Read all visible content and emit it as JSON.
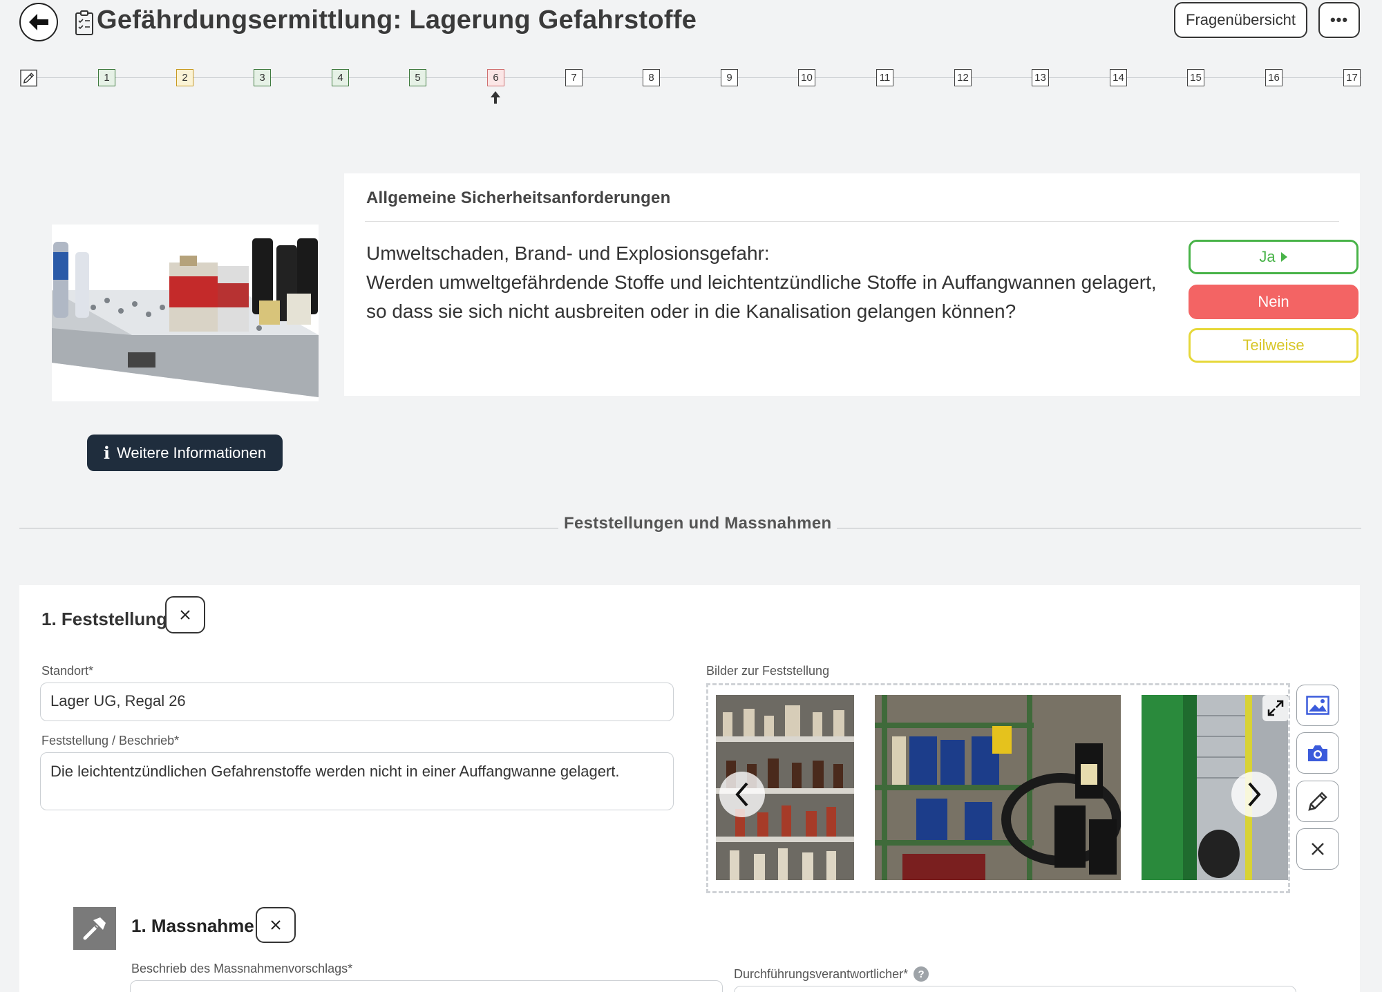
{
  "header": {
    "title": "Gefährdungsermittlung: Lagerung Gefahrstoffe",
    "overview_label": "Fragenübersicht",
    "more_label": "•••"
  },
  "stepper": {
    "current": 6,
    "steps": [
      {
        "label": "1",
        "status": "green"
      },
      {
        "label": "2",
        "status": "yellow"
      },
      {
        "label": "3",
        "status": "green"
      },
      {
        "label": "4",
        "status": "green"
      },
      {
        "label": "5",
        "status": "green"
      },
      {
        "label": "6",
        "status": "red"
      },
      {
        "label": "7",
        "status": "open"
      },
      {
        "label": "8",
        "status": "open"
      },
      {
        "label": "9",
        "status": "open"
      },
      {
        "label": "10",
        "status": "open"
      },
      {
        "label": "11",
        "status": "open"
      },
      {
        "label": "12",
        "status": "open"
      },
      {
        "label": "13",
        "status": "open"
      },
      {
        "label": "14",
        "status": "open"
      },
      {
        "label": "15",
        "status": "open"
      },
      {
        "label": "16",
        "status": "open"
      },
      {
        "label": "17",
        "status": "open"
      }
    ]
  },
  "question": {
    "section": "Allgemeine Sicherheitsanforderungen",
    "line1": "Umweltschaden, Brand- und Explosionsgefahr:",
    "line2": "Werden umweltgefährdende Stoffe und leichtentzündliche Stoffe in Auffangwannen gelagert,",
    "line3": "so dass sie sich nicht ausbreiten oder in die Kanalisation gelangen können?",
    "answers": {
      "yes": "Ja",
      "no": "Nein",
      "partial": "Teilweise"
    },
    "selected": "Nein",
    "info_button": "Weitere Informationen"
  },
  "findings": {
    "section_title": "Feststellungen und Massnahmen",
    "items": [
      {
        "title": "1. Feststellung",
        "location_label": "Standort*",
        "location_value": "Lager UG, Regal 26",
        "description_label": "Feststellung / Beschrieb*",
        "description_value": "Die leichtentzündlichen Gefahrenstoffe werden nicht in einer Auffangwanne gelagert.",
        "images_label": "Bilder zur Feststellung",
        "measures": [
          {
            "title": "1. Massnahme",
            "description_label": "Beschrieb des Massnahmenvorschlags*",
            "responsible_label": "Durchführungsverantwortlicher*",
            "help": "?"
          }
        ]
      }
    ]
  },
  "colors": {
    "yes": "#48b348",
    "no": "#f36464",
    "partial": "#e6d83a",
    "info_button": "#1f2d3d"
  }
}
